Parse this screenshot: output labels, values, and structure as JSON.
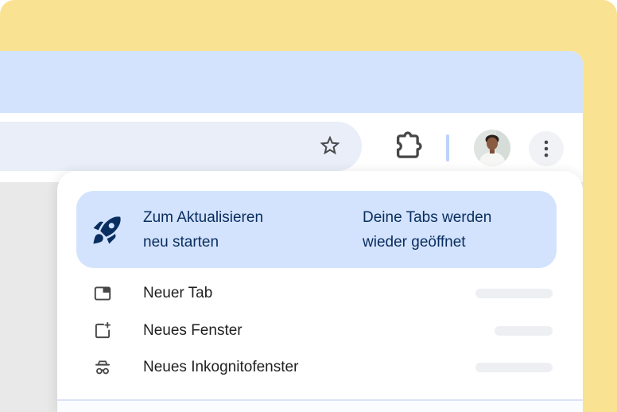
{
  "banner": {
    "action": {
      "line1": "Zum Aktualisieren",
      "line2": "neu starten"
    },
    "info": {
      "line1": "Deine Tabs werden",
      "line2": "wieder geöffnet"
    }
  },
  "menu": {
    "items": [
      {
        "label": "Neuer Tab"
      },
      {
        "label": "Neues Fenster"
      },
      {
        "label": "Neues Inkognitofenster"
      }
    ]
  },
  "colors": {
    "backdrop_yellow": "#fae293",
    "titlebar_blue": "#d3e3fd",
    "banner_blue": "#d3e3fd",
    "window_control_blue": "#1d62d4",
    "banner_text_navy": "#0a2e60",
    "menu_text": "#1f1f1f",
    "icon_gray": "#474747",
    "omnibox_gray": "#e9eef8",
    "shortcut_placeholder_gray": "#eeeff2"
  }
}
